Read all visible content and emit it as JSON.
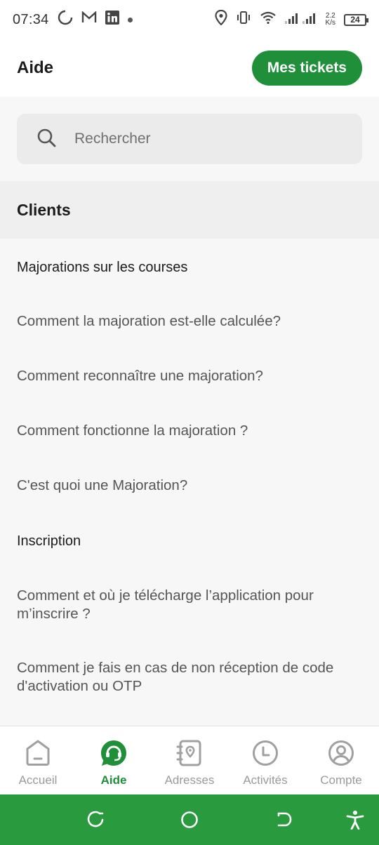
{
  "status_bar": {
    "time": "07:34",
    "net_speed_value": "2.2",
    "net_speed_unit": "K/s",
    "battery": "24"
  },
  "header": {
    "title": "Aide",
    "tickets_button": "Mes tickets"
  },
  "search": {
    "placeholder": "Rechercher",
    "icon": "search-icon"
  },
  "section": {
    "title": "Clients"
  },
  "list": {
    "items": [
      {
        "type": "category",
        "text": "Majorations sur les courses"
      },
      {
        "type": "question",
        "text": "Comment  la majoration est-elle calculée?"
      },
      {
        "type": "question",
        "text": "Comment reconnaître une majoration?"
      },
      {
        "type": "question",
        "text": "Comment fonctionne la majoration ?"
      },
      {
        "type": "question",
        "text": "C'est quoi une Majoration?"
      },
      {
        "type": "category",
        "text": "Inscription"
      },
      {
        "type": "question",
        "text": "Comment et où je télécharge l’application pour m’inscrire ?"
      },
      {
        "type": "question",
        "text": "Comment je fais en cas de non réception de code d'activation ou OTP"
      }
    ]
  },
  "bottom_nav": {
    "items": [
      {
        "label": "Accueil",
        "icon": "home-icon",
        "active": false
      },
      {
        "label": "Aide",
        "icon": "help-chat-icon",
        "active": true
      },
      {
        "label": "Adresses",
        "icon": "address-book-icon",
        "active": false
      },
      {
        "label": "Activités",
        "icon": "clock-icon",
        "active": false
      },
      {
        "label": "Compte",
        "icon": "account-icon",
        "active": false
      }
    ]
  },
  "colors": {
    "brand_green": "#1f8f3a",
    "system_nav_green": "#2a9a3e",
    "inactive": "#9a9a9a"
  }
}
